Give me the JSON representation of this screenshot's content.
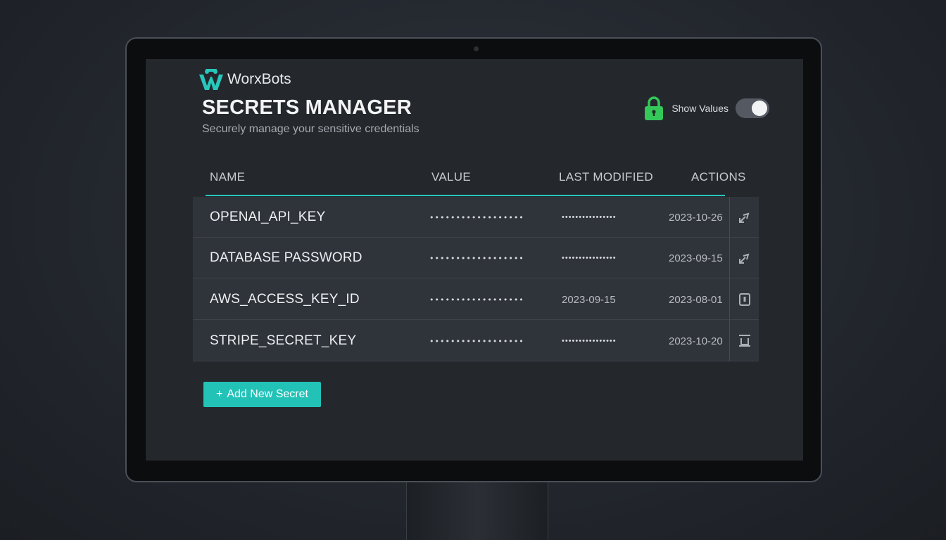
{
  "brand": {
    "name": "WorxBots",
    "accent_color": "#27c7bc"
  },
  "page": {
    "title": "SECRETS MANAGER",
    "subtitle": "Securely manage your sensitive credentials"
  },
  "toggle": {
    "label": "Show Values",
    "state": "on",
    "lock_color": "#34c759"
  },
  "table": {
    "headers": {
      "name": "NAME",
      "value": "VALUE",
      "last_modified": "LAST MODIFIED",
      "actions": "ACTIONS"
    },
    "rows": [
      {
        "name": "OPENAI_API_KEY",
        "value": "••••••••••••••••••",
        "modified_col": "••••••••••••••••",
        "date": "2023-10-26",
        "action_icon": "rotate-icon"
      },
      {
        "name": "DATABASE PASSWORD",
        "value": "••••••••••••••••••",
        "modified_col": "••••••••••••••••",
        "date": "2023-09-15",
        "action_icon": "rotate-icon"
      },
      {
        "name": "AWS_ACCESS_KEY_ID",
        "value": "••••••••••••••••••",
        "modified_col": "2023-09-15",
        "date": "2023-08-01",
        "action_icon": "edit-icon"
      },
      {
        "name": "STRIPE_SECRET_KEY",
        "value": "••••••••••••••••••",
        "modified_col": "••••••••••••••••",
        "date": "2023-10-20",
        "action_icon": "delete-icon"
      }
    ]
  },
  "add_button": {
    "label": "Add New Secret",
    "icon": "+",
    "color": "#23c2b7"
  }
}
